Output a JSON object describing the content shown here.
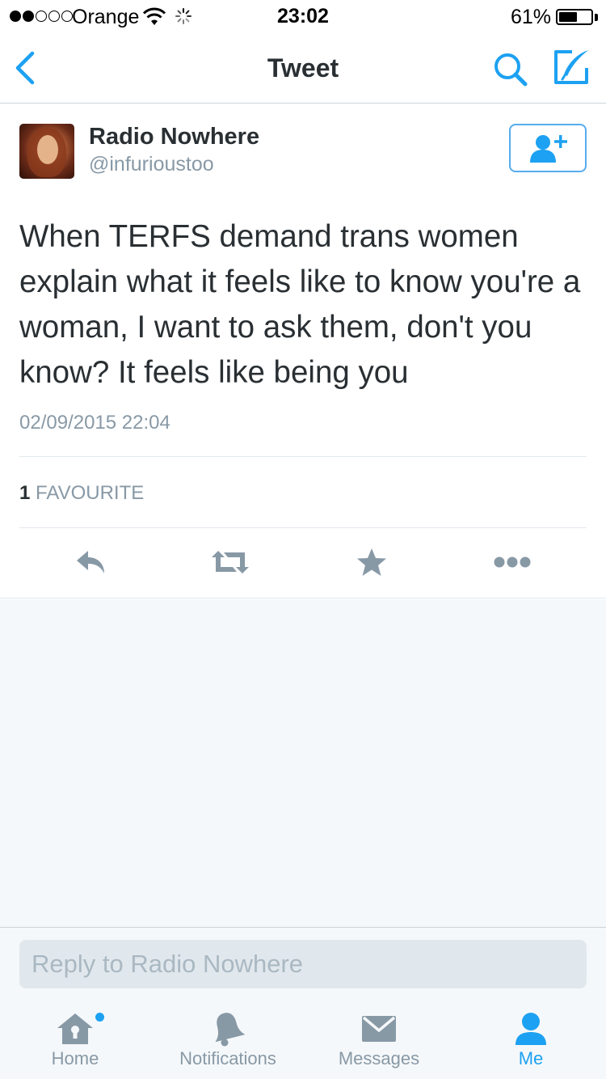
{
  "status_bar": {
    "carrier": "Orange",
    "time": "23:02",
    "battery_percent": "61%",
    "battery_level": 0.61,
    "signal_bars_filled": 2,
    "signal_bars_total": 5
  },
  "nav": {
    "title": "Tweet",
    "back_icon": "chevron-left-icon",
    "search_icon": "search-icon",
    "compose_icon": "compose-icon"
  },
  "tweet": {
    "display_name": "Radio Nowhere",
    "username": "@infurioustoo",
    "text": "When TERFS demand trans women explain what it feels like to know you're a woman, I want to ask them, don't you know? It feels like being you",
    "timestamp": "02/09/2015 22:04",
    "favourite_count": "1",
    "favourite_label": "FAVOURITE",
    "follow_icon": "follow-user-icon",
    "actions": [
      "reply-icon",
      "retweet-icon",
      "star-icon",
      "more-icon"
    ]
  },
  "reply": {
    "placeholder": "Reply to Radio Nowhere",
    "value": ""
  },
  "tabs": [
    {
      "label": "Home",
      "icon": "home-icon",
      "active": false,
      "has_dot": true
    },
    {
      "label": "Notifications",
      "icon": "bell-icon",
      "active": false,
      "has_dot": false
    },
    {
      "label": "Messages",
      "icon": "envelope-icon",
      "active": false,
      "has_dot": false
    },
    {
      "label": "Me",
      "icon": "person-icon",
      "active": true,
      "has_dot": false
    }
  ],
  "colors": {
    "accent": "#1da1f2",
    "icon_gray": "#8899a6",
    "text": "#292f33",
    "background": "#f5f8fa"
  }
}
